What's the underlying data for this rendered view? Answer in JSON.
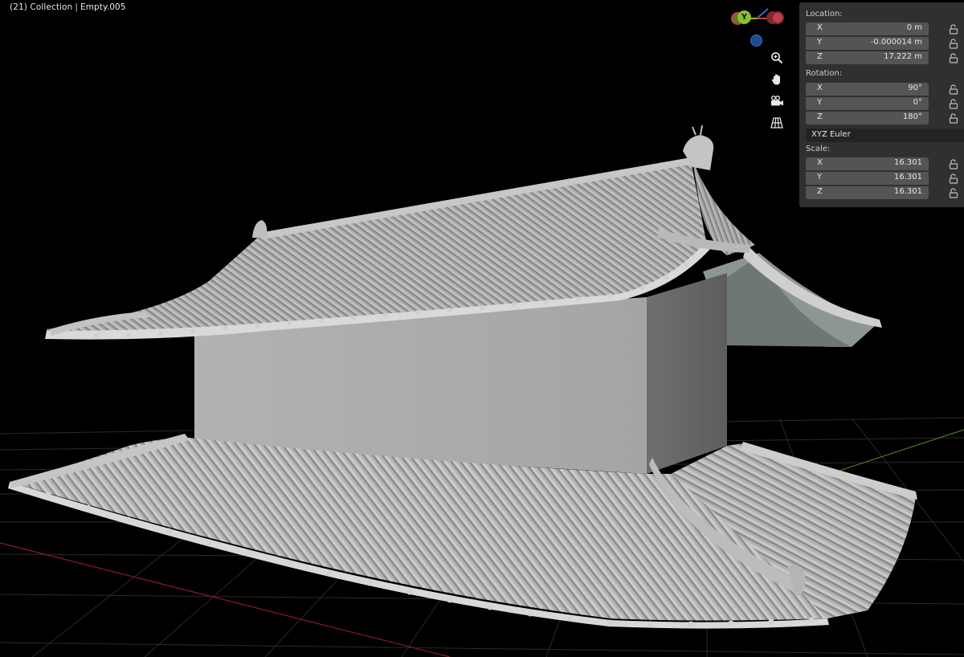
{
  "viewport": {
    "collection": "(21) Collection",
    "separator": "|",
    "active_object": "Empty.005"
  },
  "gizmo": {
    "y_axis_label": "Y",
    "axis_colors": {
      "x": "#c93b48",
      "y": "#8ac02c",
      "z": "#2f6fc9"
    }
  },
  "nav_buttons": [
    "zoom-icon",
    "pan-hand-icon",
    "camera-icon",
    "perspective-grid-icon"
  ],
  "transform_panel": {
    "location_label": "Location:",
    "location": [
      {
        "axis": "X",
        "value": "0 m"
      },
      {
        "axis": "Y",
        "value": "-0.000014 m"
      },
      {
        "axis": "Z",
        "value": "17.222 m"
      }
    ],
    "rotation_label": "Rotation:",
    "rotation": [
      {
        "axis": "X",
        "value": "90°"
      },
      {
        "axis": "Y",
        "value": "0°"
      },
      {
        "axis": "Z",
        "value": "180°"
      }
    ],
    "rotation_mode": "XYZ Euler",
    "scale_label": "Scale:",
    "scale": [
      {
        "axis": "X",
        "value": "16.301"
      },
      {
        "axis": "Y",
        "value": "16.301"
      },
      {
        "axis": "Z",
        "value": "16.301"
      }
    ]
  },
  "colors": {
    "viewport_bg": "#000000",
    "panel_bg": "#303030",
    "field_bg": "#545454",
    "model_gray": "#a9a9a9",
    "x_axis_line": "#8a1c26",
    "y_axis_line": "#4a7a1f"
  }
}
